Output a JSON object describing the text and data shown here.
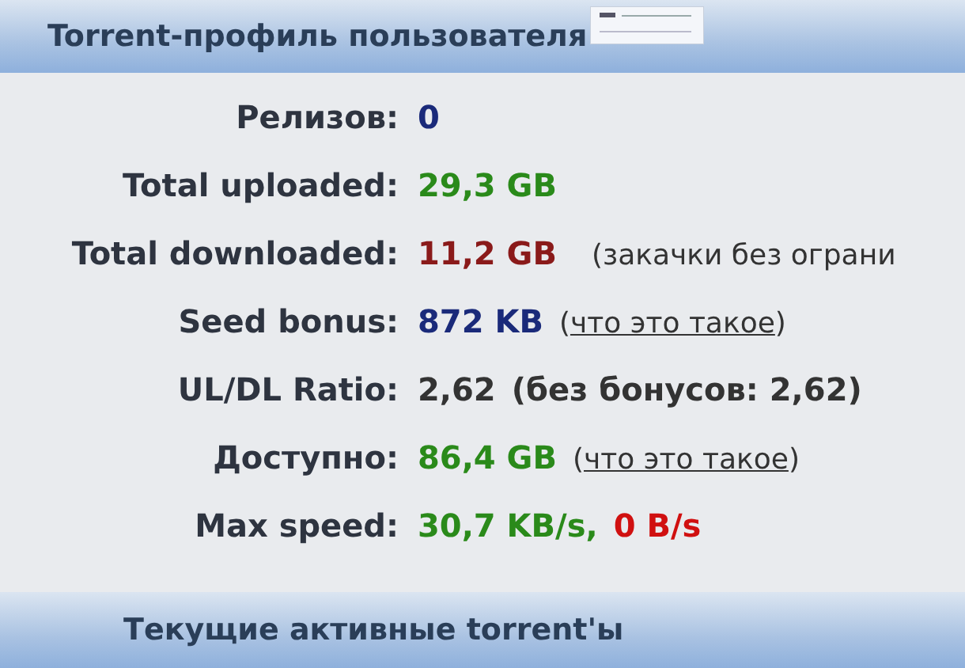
{
  "header": {
    "title": "Torrent-профиль пользователя"
  },
  "rows": [
    {
      "label": "Релизов:",
      "values": [
        {
          "text": "0",
          "color": "#1a2a7a"
        }
      ]
    },
    {
      "label": "Total uploaded:",
      "values": [
        {
          "text": "29,3 GB",
          "color": "#2a8a1a"
        }
      ]
    },
    {
      "label": "Total downloaded:",
      "values": [
        {
          "text": "11,2 GB",
          "color": "#8a1a1a"
        }
      ],
      "note": {
        "kind": "plain",
        "text": "(закачки без ограни"
      }
    },
    {
      "label": "Seed bonus:",
      "values": [
        {
          "text": "872 KB",
          "color": "#1a2a7a"
        }
      ],
      "note": {
        "kind": "link",
        "open": "(",
        "text": "что это такое",
        "close": ")"
      }
    },
    {
      "label": "UL/DL Ratio:",
      "values": [
        {
          "text": "2,62",
          "color": "#333333"
        }
      ],
      "note": {
        "kind": "bold",
        "text": "(без бонусов: 2,62)"
      }
    },
    {
      "label": "Доступно:",
      "values": [
        {
          "text": "86,4 GB",
          "color": "#2a8a1a"
        }
      ],
      "note": {
        "kind": "link",
        "open": "(",
        "text": "что это такое",
        "close": ")"
      }
    },
    {
      "label": "Max speed:",
      "values": [
        {
          "text": "30,7 KB/s,",
          "color": "#2a8a1a"
        },
        {
          "text": "0 B/s",
          "color": "#d01010"
        }
      ]
    }
  ],
  "section": {
    "title": "Текущие активные torrent'ы"
  }
}
